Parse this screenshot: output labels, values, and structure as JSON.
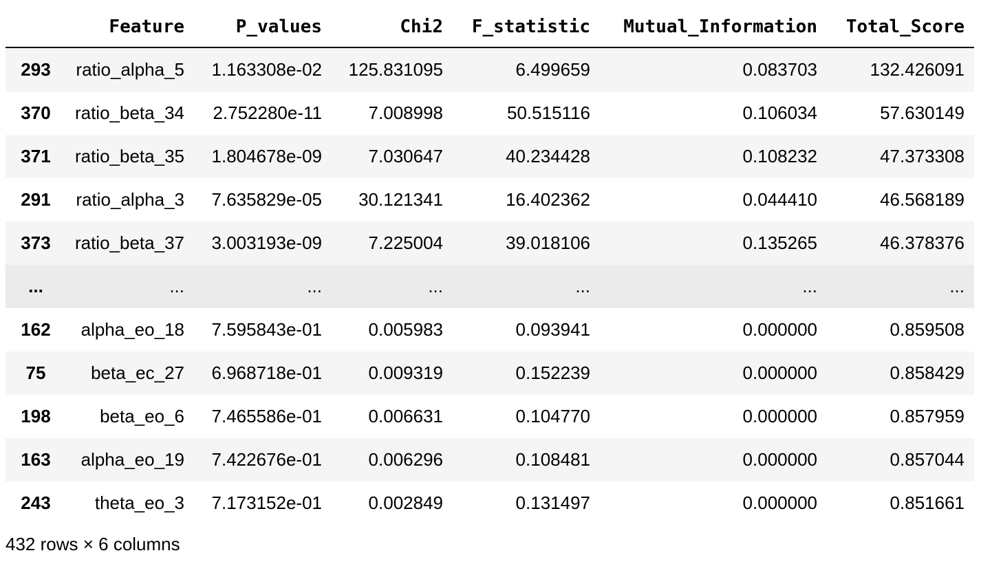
{
  "table": {
    "columns": [
      "Feature",
      "P_values",
      "Chi2",
      "F_statistic",
      "Mutual_Information",
      "Total_Score"
    ],
    "index_header": "",
    "rows": [
      {
        "index": "293",
        "cells": [
          "ratio_alpha_5",
          "1.163308e-02",
          "125.831095",
          "6.499659",
          "0.083703",
          "132.426091"
        ]
      },
      {
        "index": "370",
        "cells": [
          "ratio_beta_34",
          "2.752280e-11",
          "7.008998",
          "50.515116",
          "0.106034",
          "57.630149"
        ]
      },
      {
        "index": "371",
        "cells": [
          "ratio_beta_35",
          "1.804678e-09",
          "7.030647",
          "40.234428",
          "0.108232",
          "47.373308"
        ]
      },
      {
        "index": "291",
        "cells": [
          "ratio_alpha_3",
          "7.635829e-05",
          "30.121341",
          "16.402362",
          "0.044410",
          "46.568189"
        ]
      },
      {
        "index": "373",
        "cells": [
          "ratio_beta_37",
          "3.003193e-09",
          "7.225004",
          "39.018106",
          "0.135265",
          "46.378376"
        ]
      },
      {
        "index": "...",
        "cells": [
          "...",
          "...",
          "...",
          "...",
          "...",
          "..."
        ]
      },
      {
        "index": "162",
        "cells": [
          "alpha_eo_18",
          "7.595843e-01",
          "0.005983",
          "0.093941",
          "0.000000",
          "0.859508"
        ]
      },
      {
        "index": "75",
        "cells": [
          "beta_ec_27",
          "6.968718e-01",
          "0.009319",
          "0.152239",
          "0.000000",
          "0.858429"
        ]
      },
      {
        "index": "198",
        "cells": [
          "beta_eo_6",
          "7.465586e-01",
          "0.006631",
          "0.104770",
          "0.000000",
          "0.857959"
        ]
      },
      {
        "index": "163",
        "cells": [
          "alpha_eo_19",
          "7.422676e-01",
          "0.006296",
          "0.108481",
          "0.000000",
          "0.857044"
        ]
      },
      {
        "index": "243",
        "cells": [
          "theta_eo_3",
          "7.173152e-01",
          "0.002849",
          "0.131497",
          "0.000000",
          "0.851661"
        ]
      }
    ]
  },
  "footer": {
    "shape_text": "432 rows × 6 columns"
  },
  "colors": {
    "striped_row": "#f5f5f5",
    "plain_row": "#ffffff",
    "ellipsis_row": "#ebebeb",
    "text": "#000000"
  }
}
